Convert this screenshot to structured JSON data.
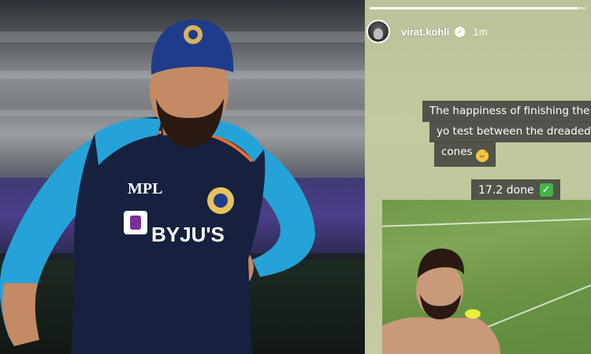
{
  "story": {
    "username": "virat.kohli",
    "time": "1m",
    "progress_fraction": 0.96,
    "caption_lines": [
      "The happiness of finishing the yo",
      "yo test between the dreaded",
      "cones"
    ],
    "badge_text": "17.2 done",
    "icons": {
      "avatar": "profile-avatar",
      "verified": "verified-badge-icon",
      "emoji": "grinning-face-emoji",
      "check": "green-check-emoji"
    }
  },
  "colors": {
    "story_bg": "#b9c29a",
    "caption_bg": "#464a42",
    "jersey_navy": "#15213f",
    "jersey_cyan": "#25a3d8",
    "cap_blue": "#1f3c8c"
  },
  "jersey": {
    "sponsor": "BYJU'S",
    "brand": "MPL"
  }
}
